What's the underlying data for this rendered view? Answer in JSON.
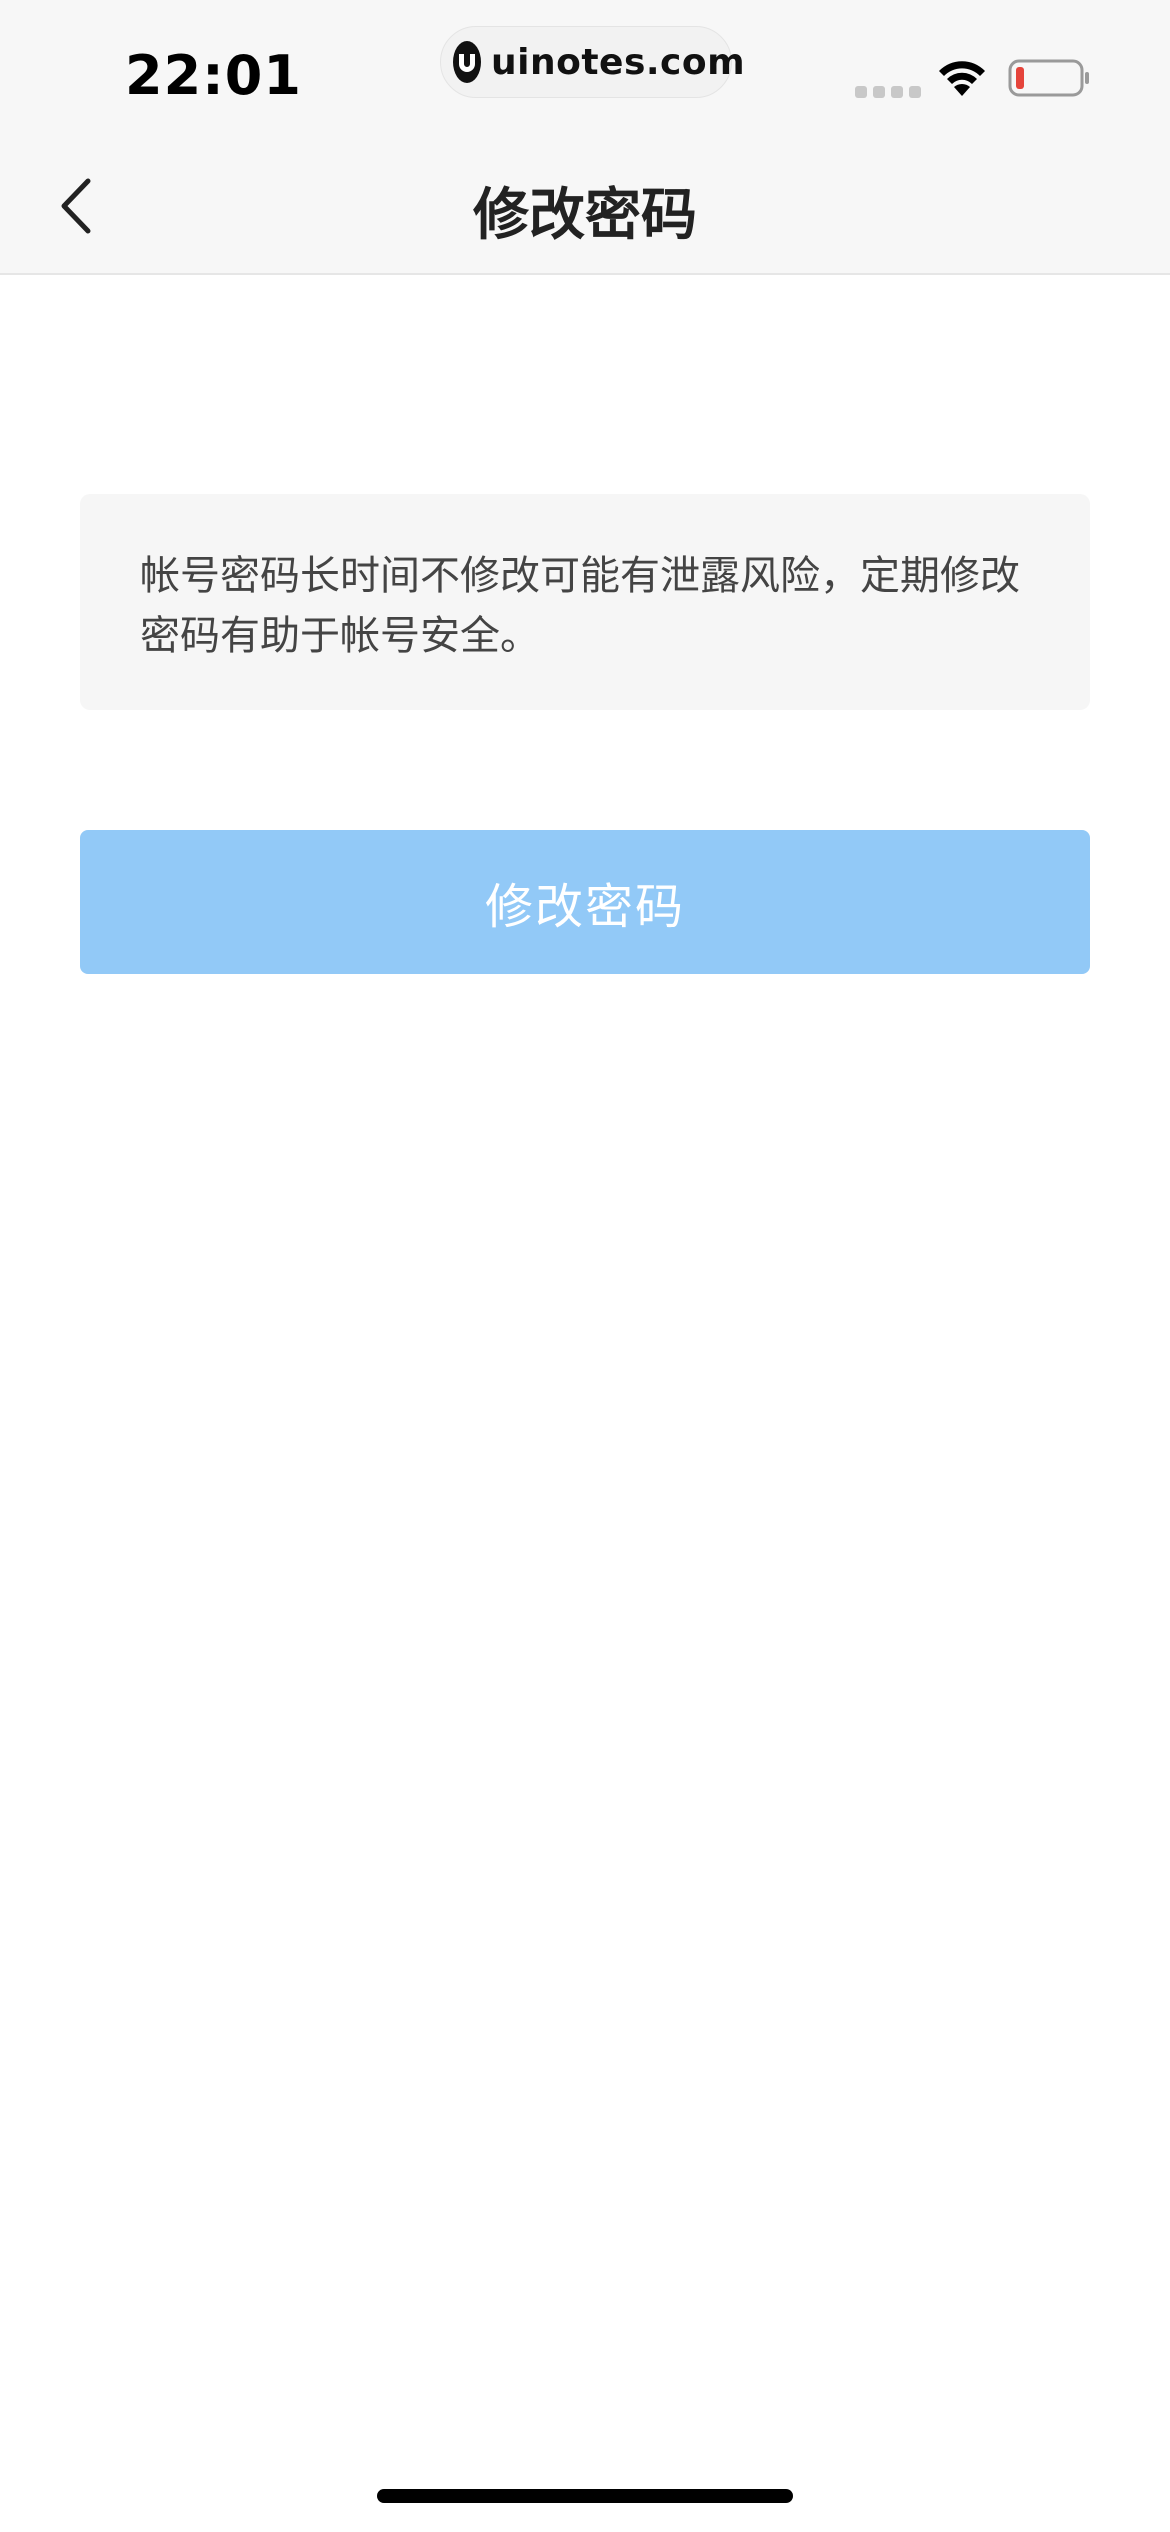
{
  "status_bar": {
    "time": "22:01",
    "watermark": "uinotes.com",
    "battery_color": "#e5443b"
  },
  "nav": {
    "back_icon": "chevron-left-icon",
    "title": "修改密码"
  },
  "notice": {
    "text": "帐号密码长时间不修改可能有泄露风险，定期修改密码有助于帐号安全。"
  },
  "action": {
    "button_label": "修改密码",
    "button_color": "#92c9f7"
  }
}
